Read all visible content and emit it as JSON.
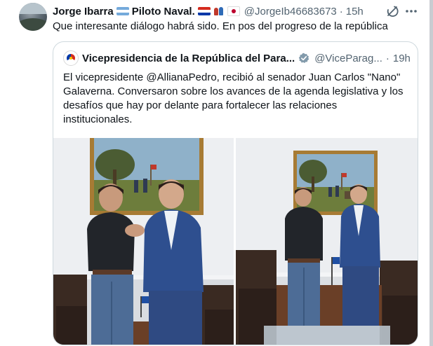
{
  "tweet": {
    "author_name": "Jorge Ibarra",
    "author_title": "Piloto Naval.",
    "handle": "@JorgeIb46683673",
    "separator": "·",
    "time": "15h",
    "text": "Que interesante diálogo habrá sido. En pos del progreso de la república",
    "icons": [
      "argentina-flag-icon",
      "paraguay-flag-icon",
      "people-emoji-icon",
      "japan-flag-icon",
      "grok-icon",
      "more-icon"
    ]
  },
  "quote": {
    "author_name": "Vicepresidencia de la República del Para...",
    "handle": "@ViceParag...",
    "separator": "·",
    "time": "19h",
    "text_lines": [
      "El vicepresidente @AllianaPedro, recibió al senador Juan Carlos \"Nano\"",
      "Galaverna. Conversaron sobre los avances de la agenda legislativa y los",
      "desafíos que hay por delante  para fortalecer las relaciones",
      "institucionales."
    ],
    "verified_color": "#829aab",
    "photos": [
      "photo-handshake",
      "photo-standing"
    ]
  },
  "colors": {
    "text": "#0f1419",
    "secondary": "#536471",
    "border": "#cfd9de"
  }
}
